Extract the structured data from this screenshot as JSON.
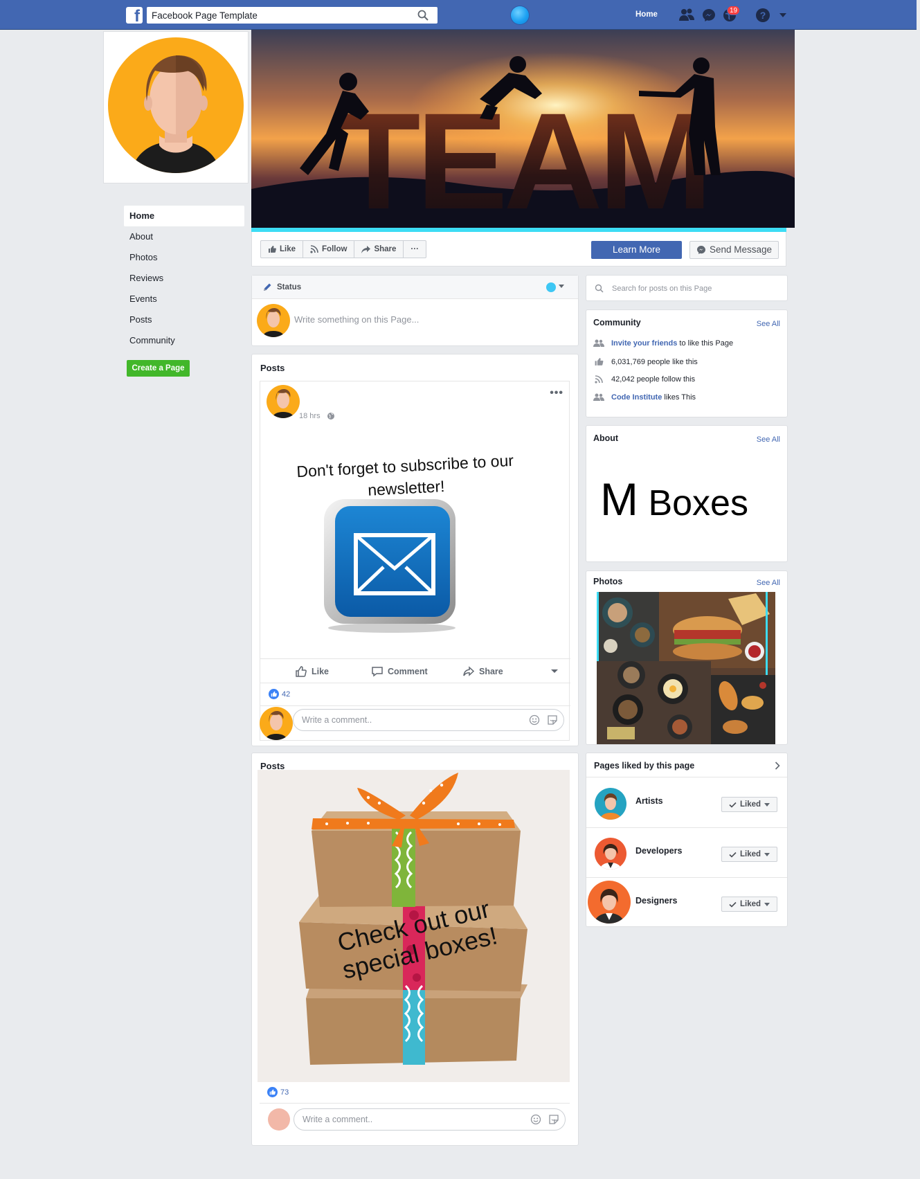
{
  "topbar": {
    "search_value": "Facebook Page Template",
    "home_label": "Home",
    "notification_count": "19"
  },
  "leftnav": {
    "items": [
      {
        "label": "Home"
      },
      {
        "label": "About"
      },
      {
        "label": "Photos"
      },
      {
        "label": "Reviews"
      },
      {
        "label": "Events"
      },
      {
        "label": "Posts"
      },
      {
        "label": "Community"
      }
    ],
    "create_page": "Create a Page"
  },
  "cover": {
    "text": "TEAM"
  },
  "actionbar": {
    "like": "Like",
    "follow": "Follow",
    "share": "Share",
    "more": "···",
    "learn_more": "Learn More",
    "send_message": "Send Message"
  },
  "status": {
    "label": "Status",
    "placeholder": "Write something on this Page..."
  },
  "post1": {
    "section_title": "Posts",
    "time": "18 hrs",
    "image_text": "Don't forget to subscribe to our newsletter!",
    "like": "Like",
    "comment": "Comment",
    "share": "Share",
    "likes": "42",
    "comment_placeholder": "Write a comment.."
  },
  "post2": {
    "section_title": "Posts",
    "image_text": "Check out our special boxes!",
    "likes": "73",
    "comment_placeholder": "Write a comment.."
  },
  "right": {
    "search_placeholder": "Search for posts on this Page",
    "community": {
      "title": "Community",
      "see_all": "See All",
      "invite_link": "Invite your friends",
      "invite_rest": "to like this Page",
      "likes": "6,031,769 people like this",
      "follows": "42,042 people follow this",
      "ci_link": "Code Institute",
      "ci_rest": "likes This"
    },
    "about": {
      "title": "About",
      "see_all": "See All",
      "brand_m": "M",
      "brand_rest": "Boxes"
    },
    "photos": {
      "title": "Photos",
      "see_all": "See All"
    },
    "pages_liked": {
      "title": "Pages liked by this page",
      "liked_label": "Liked",
      "pages": [
        {
          "name": "Artists"
        },
        {
          "name": "Developers"
        },
        {
          "name": "Designers"
        }
      ]
    }
  },
  "colors": {
    "brand_blue": "#4267b2",
    "create_green": "#42b72a",
    "accent_cyan": "#3ddcf4"
  }
}
